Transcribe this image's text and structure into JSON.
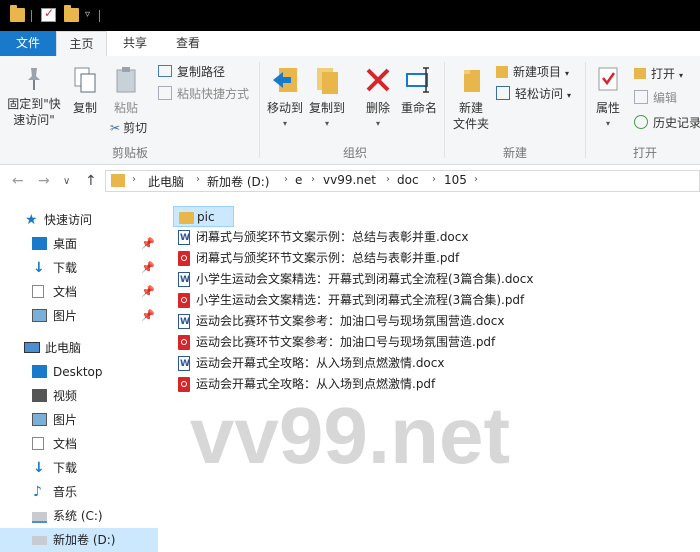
{
  "quick_access_toolbar": {
    "separator": "|",
    "dropdown": "▿"
  },
  "tabs": [
    {
      "label": "文件"
    },
    {
      "label": "主页"
    },
    {
      "label": "共享"
    },
    {
      "label": "查看"
    }
  ],
  "ribbon": {
    "clipboard": {
      "pin_label_1": "固定到\"快",
      "pin_label_2": "速访问\"",
      "copy_label": "复制",
      "paste_label": "粘贴",
      "copy_path_label": "复制路径",
      "paste_shortcut_label": "粘贴快捷方式",
      "cut_label": "剪切",
      "group_label": "剪贴板"
    },
    "organize": {
      "move_to_label": "移动到",
      "copy_to_label": "复制到",
      "delete_label": "删除",
      "rename_label": "重命名",
      "group_label": "组织"
    },
    "new": {
      "new_folder_label_1": "新建",
      "new_folder_label_2": "文件夹",
      "new_item_label": "新建项目",
      "easy_access_label": "轻松访问",
      "group_label": "新建"
    },
    "open": {
      "properties_label": "属性",
      "open_label": "打开",
      "edit_label": "编辑",
      "history_label": "历史记录",
      "group_label": "打开"
    }
  },
  "address_bar": {
    "back": "←",
    "forward": "→",
    "recent": "∨",
    "up": "↑",
    "crumbs": [
      "此电脑",
      "新加卷 (D:)",
      "e",
      "vv99.net",
      "doc",
      "105"
    ]
  },
  "nav_pane": {
    "quick_access": "快速访问",
    "quick_items": [
      {
        "label": "桌面"
      },
      {
        "label": "下载"
      },
      {
        "label": "文档"
      },
      {
        "label": "图片"
      }
    ],
    "this_pc": "此电脑",
    "pc_items": [
      {
        "label": "Desktop"
      },
      {
        "label": "视频"
      },
      {
        "label": "图片"
      },
      {
        "label": "文档"
      },
      {
        "label": "下载"
      },
      {
        "label": "音乐"
      },
      {
        "label": "系统 (C:)"
      },
      {
        "label": "新加卷 (D:)"
      }
    ]
  },
  "files": [
    {
      "name": "pic",
      "type": "folder"
    },
    {
      "name": "闭幕式与颁奖环节文案示例：总结与表彰并重.docx",
      "type": "docx"
    },
    {
      "name": "闭幕式与颁奖环节文案示例：总结与表彰并重.pdf",
      "type": "pdf"
    },
    {
      "name": "小学生运动会文案精选：开幕式到闭幕式全流程(3篇合集).docx",
      "type": "docx"
    },
    {
      "name": "小学生运动会文案精选：开幕式到闭幕式全流程(3篇合集).pdf",
      "type": "pdf"
    },
    {
      "name": "运动会比赛环节文案参考：加油口号与现场氛围营造.docx",
      "type": "docx"
    },
    {
      "name": "运动会比赛环节文案参考：加油口号与现场氛围营造.pdf",
      "type": "pdf"
    },
    {
      "name": "运动会开幕式全攻略：从入场到点燃激情.docx",
      "type": "docx"
    },
    {
      "name": "运动会开幕式全攻略：从入场到点燃激情.pdf",
      "type": "pdf"
    }
  ],
  "watermark": "vv99.net",
  "colors": {
    "accent": "#1979ca",
    "selection": "#cce8ff",
    "folder": "#e8b64a",
    "pdf": "#d6252b",
    "word": "#2b5797"
  }
}
